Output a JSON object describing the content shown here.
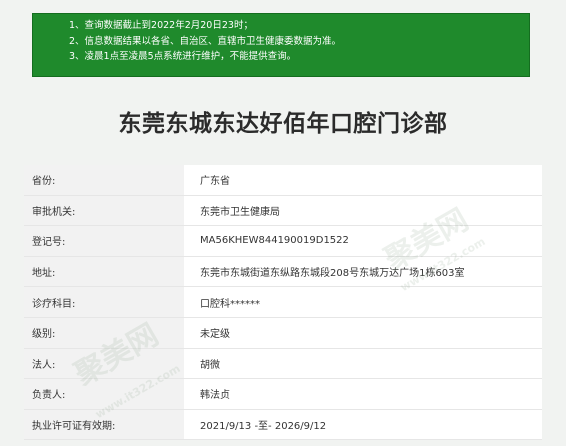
{
  "notice": {
    "lines": [
      "1、查询数据截止到2022年2月20日23时；",
      "2、信息数据结果以各省、自治区、直辖市卫生健康委数据为准。",
      "3、凌晨1点至凌晨5点系统进行维护，不能提供查询。"
    ]
  },
  "clinic_name": "东莞东城东达好佰年口腔门诊部",
  "fields": [
    {
      "label": "省份:",
      "value": "广东省"
    },
    {
      "label": "审批机关:",
      "value": "东莞市卫生健康局"
    },
    {
      "label": "登记号:",
      "value": "MA56KHEW844190019D1522"
    },
    {
      "label": "地址:",
      "value": "东莞市东城街道东纵路东城段208号东城万达广场1栋603室"
    },
    {
      "label": "诊疗科目:",
      "value": "口腔科******"
    },
    {
      "label": "级别:",
      "value": "未定级"
    },
    {
      "label": "法人:",
      "value": "胡微"
    },
    {
      "label": "负责人:",
      "value": "韩法贞"
    },
    {
      "label": "执业许可证有效期:",
      "value": "2021/9/13 -至- 2026/9/12"
    }
  ],
  "watermark": {
    "brand": "聚美网",
    "url": "www.it322.com"
  }
}
